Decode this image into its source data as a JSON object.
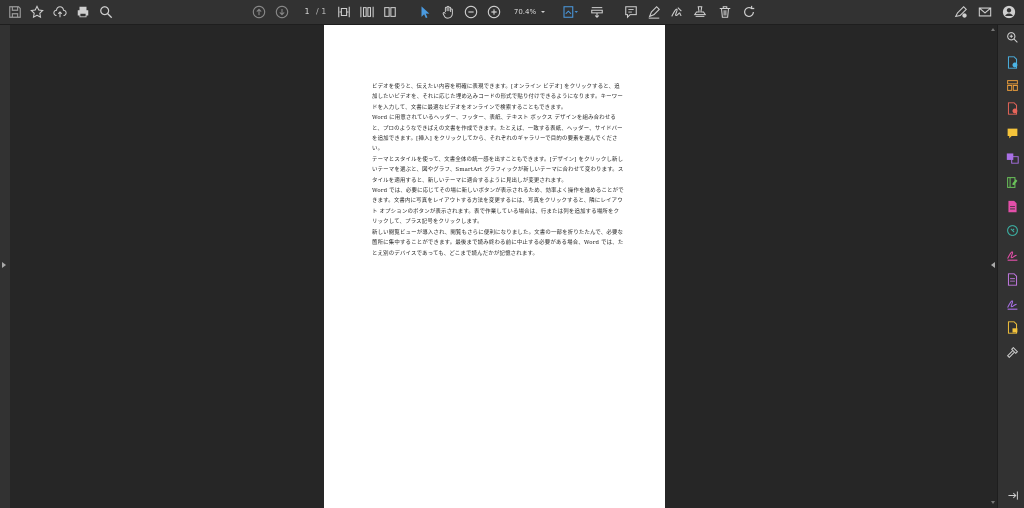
{
  "toolbar": {
    "page_current": "1",
    "page_total": "/ 1",
    "zoom": "70.4%",
    "tools_left": [
      "save-icon",
      "star-icon",
      "cloud-upload-icon",
      "print-icon",
      "search-icon"
    ],
    "tools_right": [
      "comment-icon",
      "highlight-icon",
      "sign-icon",
      "stamp-icon",
      "delete-icon",
      "rotate-icon"
    ],
    "tools_far_right": [
      "pen-settings-icon",
      "mail-icon",
      "user-icon"
    ]
  },
  "colors": {
    "accent": "#4a9ae0",
    "toolbar_bg": "#323232",
    "viewer_bg": "#262626",
    "page_bg": "#ffffff"
  },
  "document": {
    "paragraphs": [
      "ビデオを使うと、伝えたい内容を明確に表現できます。[オンライン ビデオ] をクリックすると、追加したいビデオを、それに応じた埋め込みコードの形式で貼り付けできるようになります。キーワードを入力して、文書に最適なビデオをオンラインで検索することもできます。",
      "Word に用意されているヘッダー、フッター、表紙、テキスト ボックス デザインを組み合わせると、プロのようなできばえの文書を作成できます。たとえば、一致する表紙、ヘッダー、サイドバーを追加できます。[挿入] をクリックしてから、それぞれのギャラリーで目的の要素を選んでください。",
      "テーマとスタイルを使って、文書全体の統一感を出すこともできます。[デザイン] をクリックし新しいテーマを選ぶと、図やグラフ、SmartArt グラフィックが新しいテーマに合わせて変わります。スタイルを適用すると、新しいテーマに適合するように見出しが変更されます。",
      "Word では、必要に応じてその場に新しいボタンが表示されるため、効率よく操作を進めることができます。文書内に写真をレイアウトする方法を変更するには、写真をクリックすると、隣にレイアウト オプションのボタンが表示されます。表で作業している場合は、行または列を追加する場所をクリックして、プラス記号をクリックします。",
      "新しい閲覧ビューが導入され、閲覧もさらに便利になりました。文書の一部を折りたたんで、必要な箇所に集中することができます。最後まで読み終わる前に中止する必要がある場合、Word では、たとえ別のデバイスであっても、どこまで読んだかが記憶されます。"
    ]
  },
  "right_panel": {
    "tools": [
      "zoom-icon",
      "create-pdf-icon",
      "organize-pages-icon",
      "export-pdf-icon",
      "comment-tool-icon",
      "combine-files-icon",
      "edit-pdf-icon",
      "create-pdf-alt-icon",
      "compress-icon",
      "fill-sign-icon",
      "export-icon",
      "request-signature-icon",
      "protect-icon",
      "more-tools-icon"
    ]
  }
}
